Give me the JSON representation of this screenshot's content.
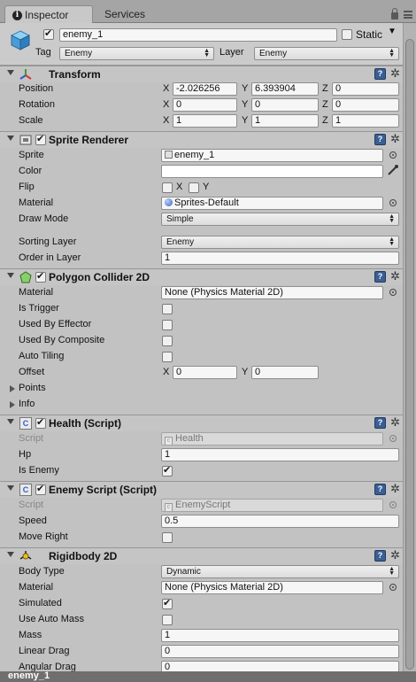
{
  "tabs": {
    "inspector": "Inspector",
    "services": "Services"
  },
  "object": {
    "name": "enemy_1",
    "active": true,
    "static_label": "Static",
    "static": false,
    "tag_label": "Tag",
    "tag": "Enemy",
    "layer_label": "Layer",
    "layer": "Enemy"
  },
  "transform": {
    "title": "Transform",
    "position_label": "Position",
    "rotation_label": "Rotation",
    "scale_label": "Scale",
    "position": {
      "x": "-2.026256",
      "y": "6.393904",
      "z": "0"
    },
    "rotation": {
      "x": "0",
      "y": "0",
      "z": "0"
    },
    "scale": {
      "x": "1",
      "y": "1",
      "z": "1"
    }
  },
  "axes": {
    "x": "X",
    "y": "Y",
    "z": "Z"
  },
  "sprite_renderer": {
    "title": "Sprite Renderer",
    "sprite_label": "Sprite",
    "sprite": "enemy_1",
    "color_label": "Color",
    "flip_label": "Flip",
    "material_label": "Material",
    "material": "Sprites-Default",
    "draw_mode_label": "Draw Mode",
    "draw_mode": "Simple",
    "sorting_layer_label": "Sorting Layer",
    "sorting_layer": "Enemy",
    "order_label": "Order in Layer",
    "order": "1"
  },
  "polygon_collider": {
    "title": "Polygon Collider 2D",
    "material_label": "Material",
    "material": "None (Physics Material 2D)",
    "is_trigger_label": "Is Trigger",
    "used_by_effector_label": "Used By Effector",
    "used_by_composite_label": "Used By Composite",
    "auto_tiling_label": "Auto Tiling",
    "offset_label": "Offset",
    "offset": {
      "x": "0",
      "y": "0"
    },
    "points_label": "Points",
    "info_label": "Info"
  },
  "health": {
    "title": "Health (Script)",
    "script_label": "Script",
    "script": "Health",
    "hp_label": "Hp",
    "hp": "1",
    "is_enemy_label": "Is Enemy",
    "is_enemy": true
  },
  "enemy_script": {
    "title": "Enemy Script (Script)",
    "script_label": "Script",
    "script": "EnemyScript",
    "speed_label": "Speed",
    "speed": "0.5",
    "move_right_label": "Move Right",
    "move_right": false
  },
  "rigidbody": {
    "title": "Rigidbody 2D",
    "body_type_label": "Body Type",
    "body_type": "Dynamic",
    "material_label": "Material",
    "material": "None (Physics Material 2D)",
    "simulated_label": "Simulated",
    "simulated": true,
    "use_auto_mass_label": "Use Auto Mass",
    "use_auto_mass": false,
    "mass_label": "Mass",
    "mass": "1",
    "linear_drag_label": "Linear Drag",
    "linear_drag": "0",
    "angular_drag_label": "Angular Drag",
    "angular_drag": "0"
  },
  "help_glyph": "?",
  "gear_glyph": "✲",
  "status": {
    "name": "enemy_1"
  }
}
